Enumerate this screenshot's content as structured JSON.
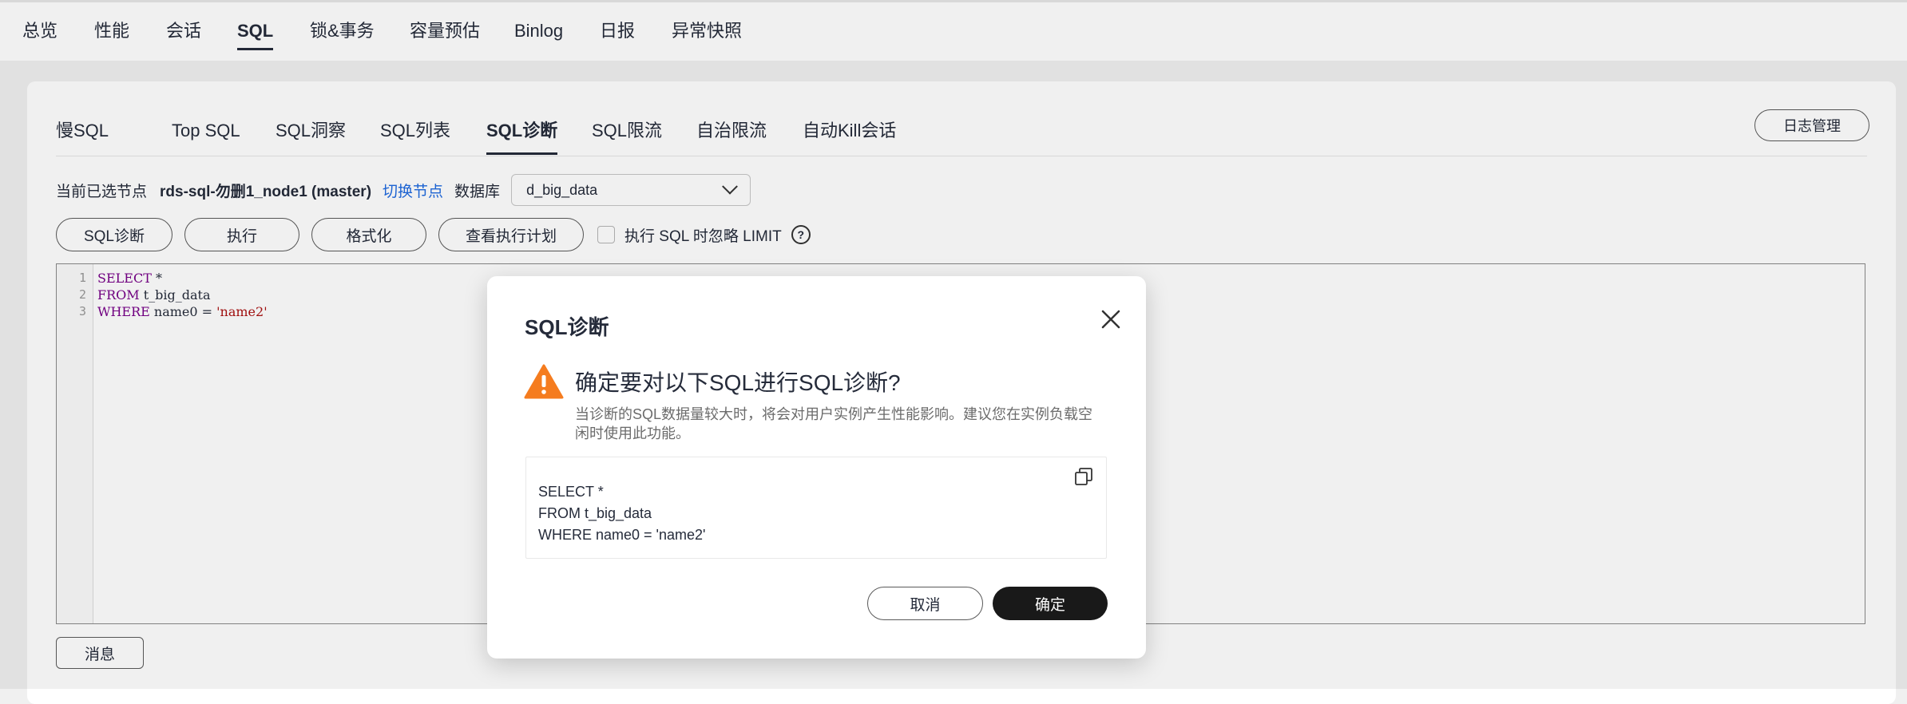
{
  "topnav": {
    "tabs": [
      {
        "label": "总览"
      },
      {
        "label": "性能"
      },
      {
        "label": "会话"
      },
      {
        "label": "SQL"
      },
      {
        "label": "锁&事务"
      },
      {
        "label": "容量预估"
      },
      {
        "label": "Binlog"
      },
      {
        "label": "日报"
      },
      {
        "label": "异常快照"
      }
    ],
    "active": "SQL"
  },
  "subtabs": {
    "items": [
      {
        "label": "慢SQL"
      },
      {
        "label": "Top SQL"
      },
      {
        "label": "SQL洞察"
      },
      {
        "label": "SQL列表"
      },
      {
        "label": "SQL诊断"
      },
      {
        "label": "SQL限流"
      },
      {
        "label": "自治限流"
      },
      {
        "label": "自动Kill会话"
      }
    ],
    "active": "SQL诊断",
    "log_button": "日志管理"
  },
  "node": {
    "label": "当前已选节点",
    "name": "rds-sql-勿删1_node1 (master)",
    "switch": "切换节点",
    "db_label": "数据库",
    "db_value": "d_big_data"
  },
  "toolbar": {
    "diagnose": "SQL诊断",
    "execute": "执行",
    "format": "格式化",
    "explain": "查看执行计划",
    "ignore_limit": "执行 SQL 时忽略 LIMIT",
    "help": "?"
  },
  "editor": {
    "line_numbers": [
      "1",
      "2",
      "3"
    ],
    "lines": [
      {
        "kw": "SELECT",
        "rest": " *",
        "str": ""
      },
      {
        "kw": "FROM",
        "rest": " t_big_data",
        "str": ""
      },
      {
        "kw": "WHERE",
        "rest": " name0 = ",
        "str": "'name2'"
      }
    ]
  },
  "message_button": "消息",
  "dialog": {
    "title": "SQL诊断",
    "warning_title": "确定要对以下SQL进行SQL诊断?",
    "warning_desc": "当诊断的SQL数据量较大时，将会对用户实例产生性能影响。建议您在实例负载空闲时使用此功能。",
    "sql": "SELECT *\nFROM t_big_data\nWHERE name0 = 'name2'",
    "cancel": "取消",
    "confirm": "确定"
  },
  "colors": {
    "accent_link": "#1f6ae0",
    "warning": "#f57c1f",
    "primary_button": "#191919"
  }
}
